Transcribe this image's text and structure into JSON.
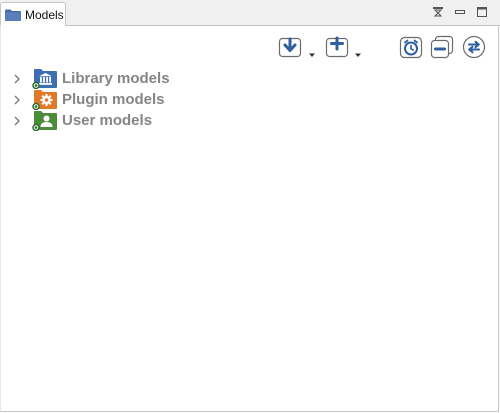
{
  "view": {
    "tab_title": "Models",
    "tab_icon": "folder-icon",
    "window_controls": [
      "restore-icon",
      "minimize-icon",
      "maximize-icon"
    ]
  },
  "toolbar": {
    "left_buttons": [
      {
        "name": "import-button",
        "icon": "download-arrow-icon",
        "has_dropdown": true
      },
      {
        "name": "add-model-button",
        "icon": "plus-icon",
        "has_dropdown": true
      }
    ],
    "right_buttons": [
      {
        "name": "history-button",
        "icon": "clock-icon"
      },
      {
        "name": "collapse-all-button",
        "icon": "minus-icon"
      },
      {
        "name": "link-editor-button",
        "icon": "sync-arrows-icon"
      }
    ]
  },
  "tree": {
    "items": [
      {
        "label": "Library models",
        "icon": "library-folder-icon",
        "expanded": false,
        "color": "#3d6db3"
      },
      {
        "label": "Plugin models",
        "icon": "plugin-folder-icon",
        "expanded": false,
        "color": "#e07a2a"
      },
      {
        "label": "User models",
        "icon": "user-folder-icon",
        "expanded": false,
        "color": "#4a8c3a"
      }
    ]
  },
  "colors": {
    "label_gray": "#858585",
    "icon_blue": "#3d6db3",
    "border": "#c5c5c5"
  }
}
